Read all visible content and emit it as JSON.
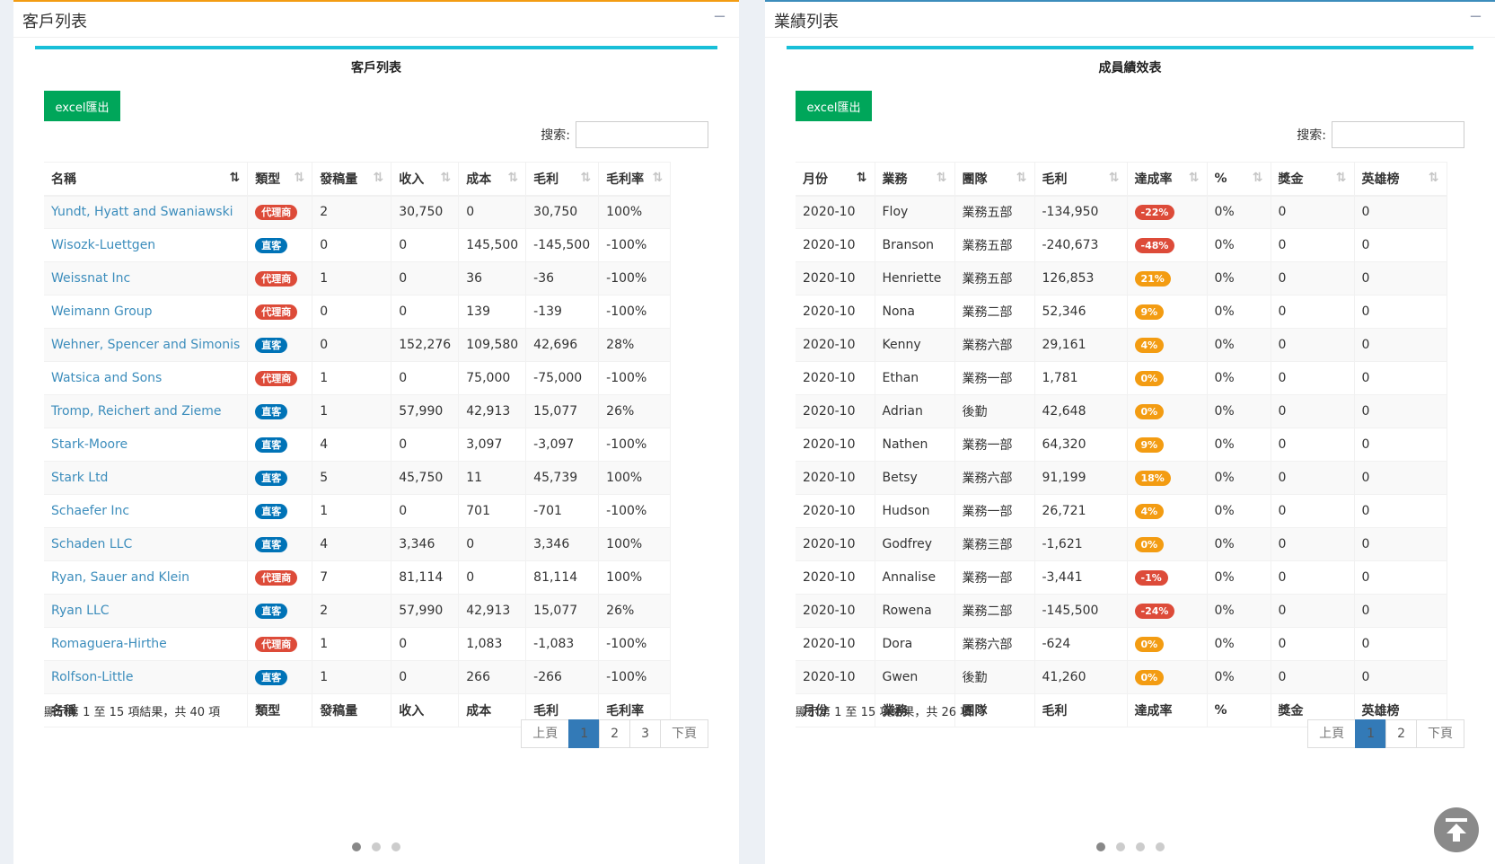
{
  "left": {
    "panel_title": "客戶列表",
    "collapse": "−",
    "table_title": "客戶列表",
    "excel_label": "excel匯出",
    "search_label": "搜索:",
    "search_value": "",
    "headers": [
      "名稱",
      "類型",
      "發稿量",
      "收入",
      "成本",
      "毛利",
      "毛利率"
    ],
    "rows": [
      {
        "name": "Yundt, Hyatt and Swaniawski",
        "type": "代理商",
        "type_color": "red",
        "count": "2",
        "income": "30,750",
        "cost": "0",
        "profit": "30,750",
        "margin": "100%"
      },
      {
        "name": "Wisozk-Luettgen",
        "type": "直客",
        "type_color": "blue",
        "count": "0",
        "income": "0",
        "cost": "145,500",
        "profit": "-145,500",
        "margin": "-100%"
      },
      {
        "name": "Weissnat Inc",
        "type": "代理商",
        "type_color": "red",
        "count": "1",
        "income": "0",
        "cost": "36",
        "profit": "-36",
        "margin": "-100%"
      },
      {
        "name": "Weimann Group",
        "type": "代理商",
        "type_color": "red",
        "count": "0",
        "income": "0",
        "cost": "139",
        "profit": "-139",
        "margin": "-100%"
      },
      {
        "name": "Wehner, Spencer and Simonis",
        "type": "直客",
        "type_color": "blue",
        "count": "0",
        "income": "152,276",
        "cost": "109,580",
        "profit": "42,696",
        "margin": "28%"
      },
      {
        "name": "Watsica and Sons",
        "type": "代理商",
        "type_color": "red",
        "count": "1",
        "income": "0",
        "cost": "75,000",
        "profit": "-75,000",
        "margin": "-100%"
      },
      {
        "name": "Tromp, Reichert and Zieme",
        "type": "直客",
        "type_color": "blue",
        "count": "1",
        "income": "57,990",
        "cost": "42,913",
        "profit": "15,077",
        "margin": "26%"
      },
      {
        "name": "Stark-Moore",
        "type": "直客",
        "type_color": "blue",
        "count": "4",
        "income": "0",
        "cost": "3,097",
        "profit": "-3,097",
        "margin": "-100%"
      },
      {
        "name": "Stark Ltd",
        "type": "直客",
        "type_color": "blue",
        "count": "5",
        "income": "45,750",
        "cost": "11",
        "profit": "45,739",
        "margin": "100%"
      },
      {
        "name": "Schaefer Inc",
        "type": "直客",
        "type_color": "blue",
        "count": "1",
        "income": "0",
        "cost": "701",
        "profit": "-701",
        "margin": "-100%"
      },
      {
        "name": "Schaden LLC",
        "type": "直客",
        "type_color": "blue",
        "count": "4",
        "income": "3,346",
        "cost": "0",
        "profit": "3,346",
        "margin": "100%"
      },
      {
        "name": "Ryan, Sauer and Klein",
        "type": "代理商",
        "type_color": "red",
        "count": "7",
        "income": "81,114",
        "cost": "0",
        "profit": "81,114",
        "margin": "100%"
      },
      {
        "name": "Ryan LLC",
        "type": "直客",
        "type_color": "blue",
        "count": "2",
        "income": "57,990",
        "cost": "42,913",
        "profit": "15,077",
        "margin": "26%"
      },
      {
        "name": "Romaguera-Hirthe",
        "type": "代理商",
        "type_color": "red",
        "count": "1",
        "income": "0",
        "cost": "1,083",
        "profit": "-1,083",
        "margin": "-100%"
      },
      {
        "name": "Rolfson-Little",
        "type": "直客",
        "type_color": "blue",
        "count": "1",
        "income": "0",
        "cost": "266",
        "profit": "-266",
        "margin": "-100%"
      }
    ],
    "info": "顯示第 1 至 15 項結果，共 40 項",
    "pager": {
      "prev": "上頁",
      "pages": [
        "1",
        "2",
        "3"
      ],
      "current": "1",
      "next": "下頁"
    },
    "dots": 3,
    "active_dot": 0
  },
  "right": {
    "panel_title": "業績列表",
    "collapse": "−",
    "table_title": "成員績效表",
    "excel_label": "excel匯出",
    "search_label": "搜索:",
    "search_value": "",
    "headers": [
      "月份",
      "業務",
      "團隊",
      "毛利",
      "達成率",
      "%",
      "獎金",
      "英雄榜"
    ],
    "rows": [
      {
        "month": "2020-10",
        "rep": "Floy",
        "team": "業務五部",
        "profit": "-134,950",
        "rate": "-22%",
        "rate_color": "red",
        "pct": "0%",
        "bonus": "0",
        "hero": "0"
      },
      {
        "month": "2020-10",
        "rep": "Branson",
        "team": "業務五部",
        "profit": "-240,673",
        "rate": "-48%",
        "rate_color": "red",
        "pct": "0%",
        "bonus": "0",
        "hero": "0"
      },
      {
        "month": "2020-10",
        "rep": "Henriette",
        "team": "業務五部",
        "profit": "126,853",
        "rate": "21%",
        "rate_color": "orange",
        "pct": "0%",
        "bonus": "0",
        "hero": "0"
      },
      {
        "month": "2020-10",
        "rep": "Nona",
        "team": "業務二部",
        "profit": "52,346",
        "rate": "9%",
        "rate_color": "orange",
        "pct": "0%",
        "bonus": "0",
        "hero": "0"
      },
      {
        "month": "2020-10",
        "rep": "Kenny",
        "team": "業務六部",
        "profit": "29,161",
        "rate": "4%",
        "rate_color": "orange",
        "pct": "0%",
        "bonus": "0",
        "hero": "0"
      },
      {
        "month": "2020-10",
        "rep": "Ethan",
        "team": "業務一部",
        "profit": "1,781",
        "rate": "0%",
        "rate_color": "orange",
        "pct": "0%",
        "bonus": "0",
        "hero": "0"
      },
      {
        "month": "2020-10",
        "rep": "Adrian",
        "team": "後勤",
        "profit": "42,648",
        "rate": "0%",
        "rate_color": "orange",
        "pct": "0%",
        "bonus": "0",
        "hero": "0"
      },
      {
        "month": "2020-10",
        "rep": "Nathen",
        "team": "業務一部",
        "profit": "64,320",
        "rate": "9%",
        "rate_color": "orange",
        "pct": "0%",
        "bonus": "0",
        "hero": "0"
      },
      {
        "month": "2020-10",
        "rep": "Betsy",
        "team": "業務六部",
        "profit": "91,199",
        "rate": "18%",
        "rate_color": "orange",
        "pct": "0%",
        "bonus": "0",
        "hero": "0"
      },
      {
        "month": "2020-10",
        "rep": "Hudson",
        "team": "業務一部",
        "profit": "26,721",
        "rate": "4%",
        "rate_color": "orange",
        "pct": "0%",
        "bonus": "0",
        "hero": "0"
      },
      {
        "month": "2020-10",
        "rep": "Godfrey",
        "team": "業務三部",
        "profit": "-1,621",
        "rate": "0%",
        "rate_color": "orange",
        "pct": "0%",
        "bonus": "0",
        "hero": "0"
      },
      {
        "month": "2020-10",
        "rep": "Annalise",
        "team": "業務一部",
        "profit": "-3,441",
        "rate": "-1%",
        "rate_color": "red",
        "pct": "0%",
        "bonus": "0",
        "hero": "0"
      },
      {
        "month": "2020-10",
        "rep": "Rowena",
        "team": "業務二部",
        "profit": "-145,500",
        "rate": "-24%",
        "rate_color": "red",
        "pct": "0%",
        "bonus": "0",
        "hero": "0"
      },
      {
        "month": "2020-10",
        "rep": "Dora",
        "team": "業務六部",
        "profit": "-624",
        "rate": "0%",
        "rate_color": "orange",
        "pct": "0%",
        "bonus": "0",
        "hero": "0"
      },
      {
        "month": "2020-10",
        "rep": "Gwen",
        "team": "後勤",
        "profit": "41,260",
        "rate": "0%",
        "rate_color": "orange",
        "pct": "0%",
        "bonus": "0",
        "hero": "0"
      }
    ],
    "info": "顯示第 1 至 15 項結果，共 26 項",
    "pager": {
      "prev": "上頁",
      "pages": [
        "1",
        "2"
      ],
      "current": "1",
      "next": "下頁"
    },
    "dots": 4,
    "active_dot": 0
  },
  "icons": {
    "sort": "sort-icon",
    "scroll_top": "arrow-up-to-top-icon"
  },
  "colors": {
    "accent_left": "#f39c12",
    "accent_right": "#3c8dbc",
    "tab_line": "#18bfd8",
    "excel": "#00a65a",
    "tag_red": "#dd4b39",
    "tag_blue": "#0073b7",
    "tag_orange": "#f39c12",
    "pager_active": "#337ab7"
  }
}
